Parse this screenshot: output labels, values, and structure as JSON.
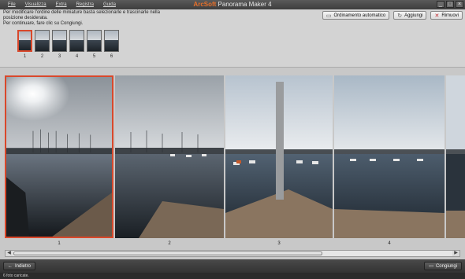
{
  "app": {
    "brand": "ArcSoft",
    "title": "Panorama Maker 4"
  },
  "menu": [
    "File",
    "Visualizza",
    "Extra",
    "Registra",
    "Guida"
  ],
  "window_buttons": [
    "_",
    "□",
    "×"
  ],
  "instructions": {
    "line1": "Per modificare l'ordine delle miniature basta selezionarle e trascinarle nella posizione desiderata.",
    "line2": "Per continuare, fare clic su Congiungi."
  },
  "toolbar": {
    "sort_label": "Ordinamento automatico",
    "add_label": "Aggiungi",
    "remove_label": "Rimuovi"
  },
  "thumbnails": [
    "1",
    "2",
    "3",
    "4",
    "5",
    "6"
  ],
  "frames": [
    "1",
    "2",
    "3",
    "4"
  ],
  "bottom": {
    "back_label": "Indietro",
    "join_label": "Congiungi"
  },
  "status": "6 foto caricate.",
  "colors": {
    "selection": "#d9482b",
    "brand": "#e8702a"
  }
}
